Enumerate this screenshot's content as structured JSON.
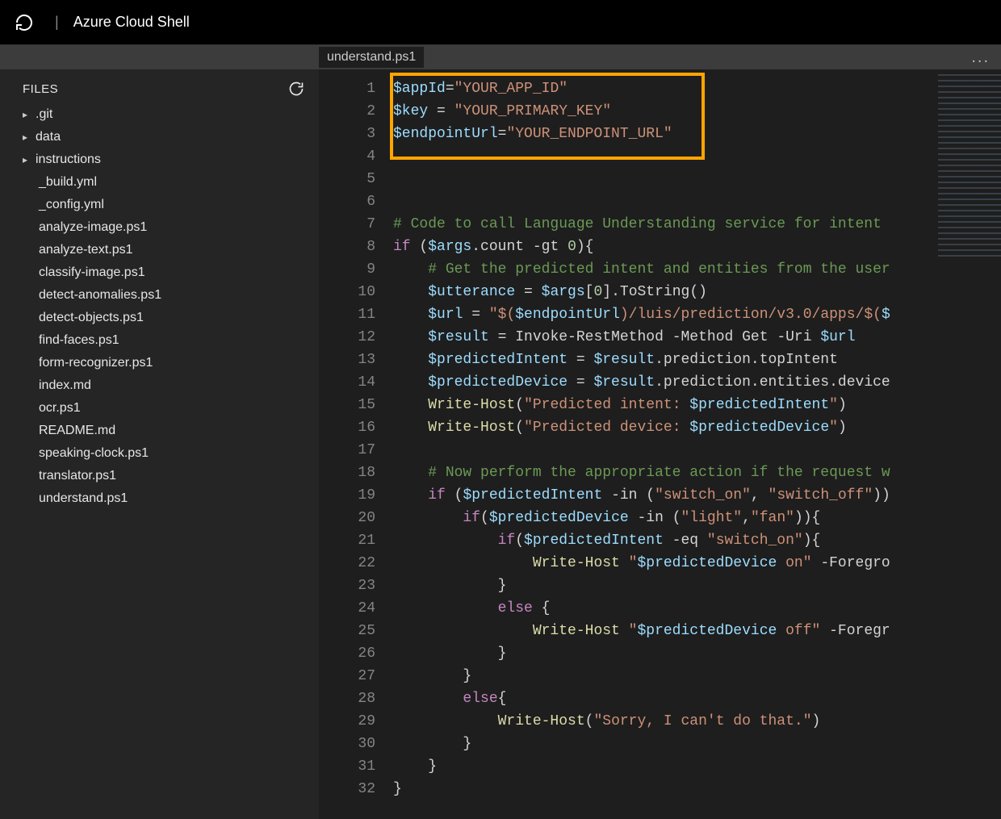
{
  "header": {
    "title": "Azure Cloud Shell"
  },
  "tab": {
    "filename": "understand.ps1",
    "menu_dots": "..."
  },
  "sidebar": {
    "section_label": "FILES",
    "folders": [
      {
        "name": ".git"
      },
      {
        "name": "data"
      },
      {
        "name": "instructions"
      }
    ],
    "files": [
      "_build.yml",
      "_config.yml",
      "analyze-image.ps1",
      "analyze-text.ps1",
      "classify-image.ps1",
      "detect-anomalies.ps1",
      "detect-objects.ps1",
      "find-faces.ps1",
      "form-recognizer.ps1",
      "index.md",
      "ocr.ps1",
      "README.md",
      "speaking-clock.ps1",
      "translator.ps1",
      "understand.ps1"
    ]
  },
  "editor": {
    "line_count": 32,
    "tokens": {
      "l1": {
        "var": "$appId",
        "op": "=",
        "str": "\"YOUR_APP_ID\""
      },
      "l2": {
        "var": "$key",
        "op": " = ",
        "str": "\"YOUR_PRIMARY_KEY\""
      },
      "l3": {
        "var": "$endpointUrl",
        "op": "=",
        "str": "\"YOUR_ENDPOINT_URL\""
      },
      "l7": {
        "com": "# Code to call Language Understanding service for intent"
      },
      "l8": {
        "kw": "if",
        "pl1": " (",
        "var": "$args",
        "pl2": ".count ",
        "op": "-gt",
        "num": " 0",
        "pl3": "){"
      },
      "l9": {
        "com": "# Get the predicted intent and entities from the user"
      },
      "l10": {
        "var1": "$utterance",
        "op": " = ",
        "var2": "$args",
        "pl": "[",
        "num": "0",
        "pl2": "].ToString()"
      },
      "l11": {
        "var1": "$url",
        "op": " = ",
        "str1": "\"$(",
        "var2": "$endpointUrl",
        "str2": ")/luis/prediction/v3.0/apps/$(",
        "var3": "$"
      },
      "l12": {
        "var1": "$result",
        "op1": " = ",
        "cmd": "Invoke-RestMethod",
        "op2": " -Method ",
        "pl1": "Get",
        "op3": " -Uri ",
        "var2": "$url"
      },
      "l13": {
        "var1": "$predictedIntent",
        "op": " = ",
        "var2": "$result",
        "pl": ".prediction.topIntent"
      },
      "l14": {
        "var1": "$predictedDevice",
        "op": " = ",
        "var2": "$result",
        "pl": ".prediction.entities.device"
      },
      "l15": {
        "fn": "Write-Host",
        "pl1": "(",
        "str1": "\"Predicted intent: ",
        "var": "$predictedIntent",
        "str2": "\"",
        "pl2": ")"
      },
      "l16": {
        "fn": "Write-Host",
        "pl1": "(",
        "str1": "\"Predicted device: ",
        "var": "$predictedDevice",
        "str2": "\"",
        "pl2": ")"
      },
      "l18": {
        "com": "# Now perform the appropriate action if the request w"
      },
      "l19": {
        "kw": "if",
        "pl1": " (",
        "var": "$predictedIntent",
        "op": " -in ",
        "pl2": "(",
        "str1": "\"switch_on\"",
        "pl3": ", ",
        "str2": "\"switch_off\"",
        "pl4": "))"
      },
      "l20": {
        "kw": "if",
        "pl1": "(",
        "var": "$predictedDevice",
        "op": " -in ",
        "pl2": "(",
        "str1": "\"light\"",
        "pl3": ",",
        "str2": "\"fan\"",
        "pl4": ")){"
      },
      "l21": {
        "kw": "if",
        "pl1": "(",
        "var": "$predictedIntent",
        "op": " -eq ",
        "str": "\"switch_on\"",
        "pl2": "){"
      },
      "l22": {
        "fn": "Write-Host",
        "str1": " \"",
        "var": "$predictedDevice",
        "str2": " on\"",
        "op": " -Foregro"
      },
      "l23": {
        "pl": "}"
      },
      "l24": {
        "kw": "else",
        "pl": " {"
      },
      "l25": {
        "fn": "Write-Host",
        "str1": " \"",
        "var": "$predictedDevice",
        "str2": " off\"",
        "op": " -Foregr"
      },
      "l26": {
        "pl": "}"
      },
      "l27": {
        "pl": "}"
      },
      "l28": {
        "kw": "else",
        "pl": "{"
      },
      "l29": {
        "fn": "Write-Host",
        "pl1": "(",
        "str": "\"Sorry, I can't do that.\"",
        "pl2": ")"
      },
      "l30": {
        "pl": "}"
      },
      "l31": {
        "pl": "}"
      },
      "l32": {
        "pl": "}"
      }
    }
  }
}
